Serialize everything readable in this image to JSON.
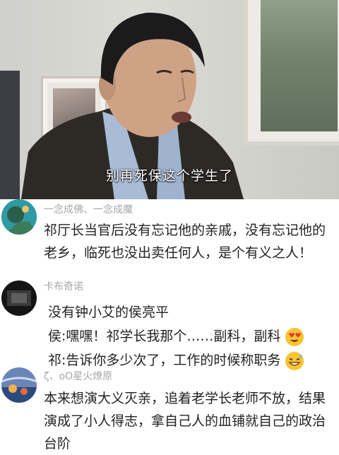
{
  "video": {
    "subtitle": "别再死保这个学生了"
  },
  "comments": [
    {
      "username": "一念成佛、一念成魔",
      "text": "祁厅长当官后没有忘记他的亲戚，没有忘记他的老乡，临死也没出卖任何人，是个有义之人！"
    },
    {
      "username": "卡布奇诺",
      "lines": [
        "没有钟小艾的侯亮平",
        "侯:嘿嘿！祁学长我那个……副科，副科",
        "祁:告诉你多少次了，工作的时候称职务"
      ],
      "emojis": [
        "heart-eyes-emoji",
        "grinning-sweat-emoji"
      ]
    },
    {
      "username": "ζ、oO星火燎原",
      "text": "本来想演大义灭亲，追着老学长老师不放，结果演成了小人得志，拿自己人的血铺就自己的政治台阶"
    }
  ]
}
